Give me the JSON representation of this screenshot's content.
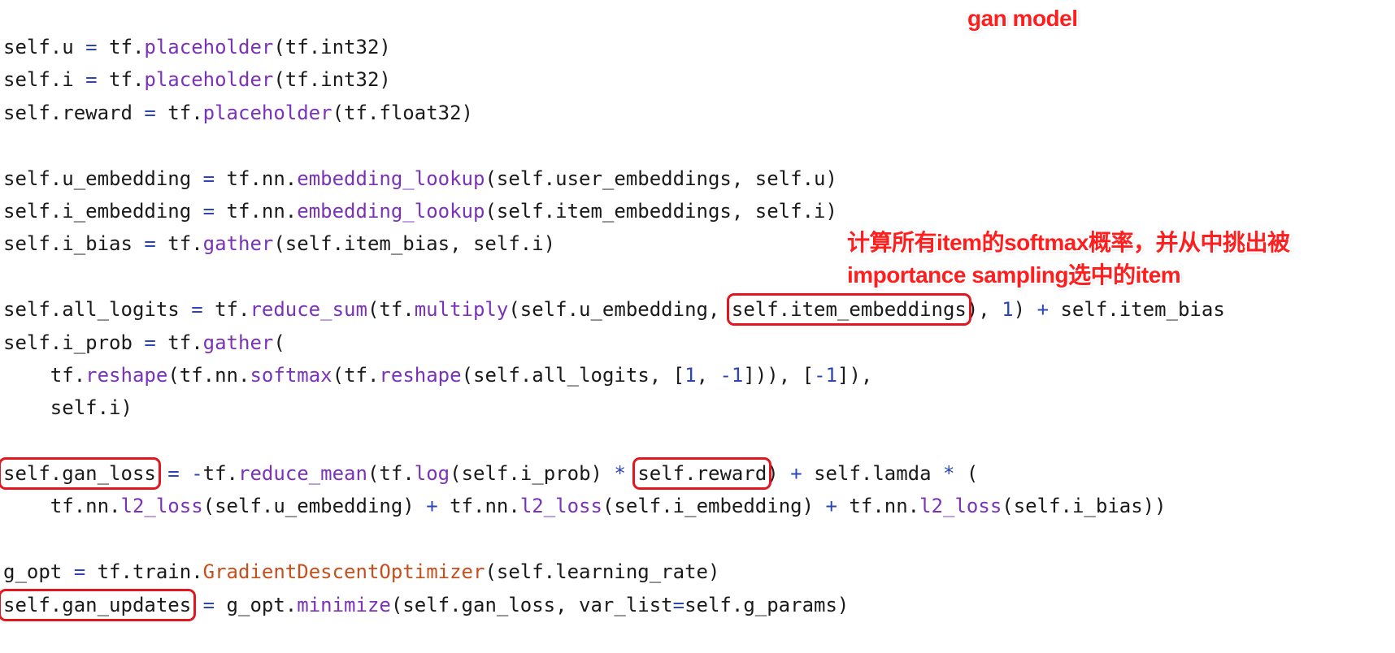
{
  "annotations": {
    "title": "gan model",
    "softmax_note_line1": "计算所有item的softmax概率，并从中挑出被",
    "softmax_note_line2": "importance sampling选中的item"
  },
  "colors": {
    "background": "#ffffff",
    "text": "#1a1a1a",
    "operator": "#2b46b8",
    "function": "#7a32b8",
    "number": "#2b46b8",
    "class": "#c5501c",
    "annotation": "#ff1e1e",
    "highlight_box": "#e3161f"
  },
  "code_lines": [
    [
      {
        "t": "self.u ",
        "c": "plain"
      },
      {
        "t": "=",
        "c": "op"
      },
      {
        "t": " tf.",
        "c": "plain"
      },
      {
        "t": "placeholder",
        "c": "fn"
      },
      {
        "t": "(tf.int32)",
        "c": "plain"
      }
    ],
    [
      {
        "t": "self.i ",
        "c": "plain"
      },
      {
        "t": "=",
        "c": "op"
      },
      {
        "t": " tf.",
        "c": "plain"
      },
      {
        "t": "placeholder",
        "c": "fn"
      },
      {
        "t": "(tf.int32)",
        "c": "plain"
      }
    ],
    [
      {
        "t": "self.reward ",
        "c": "plain"
      },
      {
        "t": "=",
        "c": "op"
      },
      {
        "t": " tf.",
        "c": "plain"
      },
      {
        "t": "placeholder",
        "c": "fn"
      },
      {
        "t": "(tf.float32)",
        "c": "plain"
      }
    ],
    [],
    [
      {
        "t": "self.u_embedding ",
        "c": "plain"
      },
      {
        "t": "=",
        "c": "op"
      },
      {
        "t": " tf.nn.",
        "c": "plain"
      },
      {
        "t": "embedding_lookup",
        "c": "fn"
      },
      {
        "t": "(self.user_embeddings, self.u)",
        "c": "plain"
      }
    ],
    [
      {
        "t": "self.i_embedding ",
        "c": "plain"
      },
      {
        "t": "=",
        "c": "op"
      },
      {
        "t": " tf.nn.",
        "c": "plain"
      },
      {
        "t": "embedding_lookup",
        "c": "fn"
      },
      {
        "t": "(self.item_embeddings, self.i)",
        "c": "plain"
      }
    ],
    [
      {
        "t": "self.i_bias ",
        "c": "plain"
      },
      {
        "t": "=",
        "c": "op"
      },
      {
        "t": " tf.",
        "c": "plain"
      },
      {
        "t": "gather",
        "c": "fn"
      },
      {
        "t": "(self.item_bias, self.i)",
        "c": "plain"
      }
    ],
    [],
    [
      {
        "t": "self.all_logits ",
        "c": "plain"
      },
      {
        "t": "=",
        "c": "op"
      },
      {
        "t": " tf.",
        "c": "plain"
      },
      {
        "t": "reduce_sum",
        "c": "fn"
      },
      {
        "t": "(tf.",
        "c": "plain"
      },
      {
        "t": "multiply",
        "c": "fn"
      },
      {
        "t": "(self.u_embedding, ",
        "c": "plain"
      },
      {
        "t": "self.item_embeddings",
        "c": "hl"
      },
      {
        "t": "), ",
        "c": "plain"
      },
      {
        "t": "1",
        "c": "num"
      },
      {
        "t": ") ",
        "c": "plain"
      },
      {
        "t": "+",
        "c": "op"
      },
      {
        "t": " self.item_bias",
        "c": "plain"
      }
    ],
    [
      {
        "t": "self.i_prob ",
        "c": "plain"
      },
      {
        "t": "=",
        "c": "op"
      },
      {
        "t": " tf.",
        "c": "plain"
      },
      {
        "t": "gather",
        "c": "fn"
      },
      {
        "t": "(",
        "c": "plain"
      }
    ],
    [
      {
        "t": "    tf.",
        "c": "plain"
      },
      {
        "t": "reshape",
        "c": "fn"
      },
      {
        "t": "(tf.nn.",
        "c": "plain"
      },
      {
        "t": "softmax",
        "c": "fn"
      },
      {
        "t": "(tf.",
        "c": "plain"
      },
      {
        "t": "reshape",
        "c": "fn"
      },
      {
        "t": "(self.all_logits, [",
        "c": "plain"
      },
      {
        "t": "1",
        "c": "num"
      },
      {
        "t": ", ",
        "c": "plain"
      },
      {
        "t": "-1",
        "c": "num"
      },
      {
        "t": "])), [",
        "c": "plain"
      },
      {
        "t": "-1",
        "c": "num"
      },
      {
        "t": "]),",
        "c": "plain"
      }
    ],
    [
      {
        "t": "    self.i)",
        "c": "plain"
      }
    ],
    [],
    [
      {
        "t": "self.gan_loss",
        "c": "hl"
      },
      {
        "t": " ",
        "c": "plain"
      },
      {
        "t": "=",
        "c": "op"
      },
      {
        "t": " ",
        "c": "plain"
      },
      {
        "t": "-",
        "c": "op"
      },
      {
        "t": "tf.",
        "c": "plain"
      },
      {
        "t": "reduce_mean",
        "c": "fn"
      },
      {
        "t": "(tf.",
        "c": "plain"
      },
      {
        "t": "log",
        "c": "fn"
      },
      {
        "t": "(self.i_prob) ",
        "c": "plain"
      },
      {
        "t": "*",
        "c": "op"
      },
      {
        "t": " ",
        "c": "plain"
      },
      {
        "t": "self.reward",
        "c": "hl"
      },
      {
        "t": ") ",
        "c": "plain"
      },
      {
        "t": "+",
        "c": "op"
      },
      {
        "t": " self.lamda ",
        "c": "plain"
      },
      {
        "t": "*",
        "c": "op"
      },
      {
        "t": " (",
        "c": "plain"
      }
    ],
    [
      {
        "t": "    tf.nn.",
        "c": "plain"
      },
      {
        "t": "l2_loss",
        "c": "fn"
      },
      {
        "t": "(self.u_embedding) ",
        "c": "plain"
      },
      {
        "t": "+",
        "c": "op"
      },
      {
        "t": " tf.nn.",
        "c": "plain"
      },
      {
        "t": "l2_loss",
        "c": "fn"
      },
      {
        "t": "(self.i_embedding) ",
        "c": "plain"
      },
      {
        "t": "+",
        "c": "op"
      },
      {
        "t": " tf.nn.",
        "c": "plain"
      },
      {
        "t": "l2_loss",
        "c": "fn"
      },
      {
        "t": "(self.i_bias))",
        "c": "plain"
      }
    ],
    [],
    [
      {
        "t": "g_opt ",
        "c": "plain"
      },
      {
        "t": "=",
        "c": "op"
      },
      {
        "t": " tf.train.",
        "c": "plain"
      },
      {
        "t": "GradientDescentOptimizer",
        "c": "cls"
      },
      {
        "t": "(self.learning_rate)",
        "c": "plain"
      }
    ],
    [
      {
        "t": "self.gan_updates",
        "c": "hl"
      },
      {
        "t": " ",
        "c": "plain"
      },
      {
        "t": "=",
        "c": "op"
      },
      {
        "t": " g_opt.",
        "c": "plain"
      },
      {
        "t": "minimize",
        "c": "fn"
      },
      {
        "t": "(self.gan_loss, var_list",
        "c": "plain"
      },
      {
        "t": "=",
        "c": "op"
      },
      {
        "t": "self.g_params)",
        "c": "plain"
      }
    ]
  ]
}
